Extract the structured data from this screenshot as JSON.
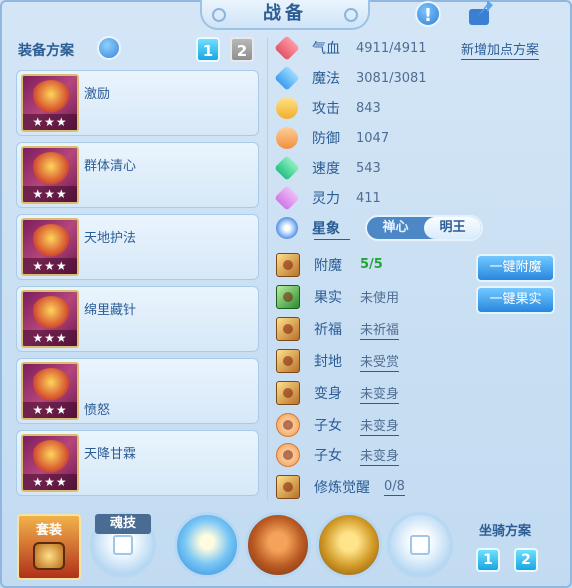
{
  "title": "战备",
  "equip_plan": {
    "label": "装备方案",
    "pages": [
      "1",
      "2"
    ],
    "items": [
      {
        "name": "激励",
        "stars": "★★★"
      },
      {
        "name": "群体清心",
        "stars": "★★★"
      },
      {
        "name": "天地护法",
        "stars": "★★★"
      },
      {
        "name": "绵里藏针",
        "stars": "★★★"
      },
      {
        "name": "愤怒",
        "stars": "★★★"
      },
      {
        "name": "天降甘霖",
        "stars": "★★★"
      }
    ]
  },
  "add_point_plan": "新增加点方案",
  "attributes": [
    {
      "name": "气血",
      "value": "4911/4911",
      "icon": "heart-icon"
    },
    {
      "name": "魔法",
      "value": "3081/3081",
      "icon": "mana-icon"
    },
    {
      "name": "攻击",
      "value": "843",
      "icon": "attack-icon"
    },
    {
      "name": "防御",
      "value": "1047",
      "icon": "defense-icon"
    },
    {
      "name": "速度",
      "value": "543",
      "icon": "speed-icon"
    },
    {
      "name": "灵力",
      "value": "411",
      "icon": "spirit-icon"
    }
  ],
  "star_sign": {
    "label": "星象",
    "options": [
      "禅心",
      "明王"
    ],
    "selected": "明王"
  },
  "specials": [
    {
      "name": "附魔",
      "value": "5/5"
    },
    {
      "name": "果实",
      "value": "未使用"
    },
    {
      "name": "祈福",
      "value": "未祈福"
    },
    {
      "name": "封地",
      "value": "未受赏"
    },
    {
      "name": "变身",
      "value": "未变身"
    },
    {
      "name": "子女",
      "value": "未变身"
    },
    {
      "name": "子女",
      "value": "未变身"
    },
    {
      "name": "修炼觉醒",
      "value": "0/8"
    }
  ],
  "actions": {
    "enchant": "一键附魔",
    "fruit": "一键果实"
  },
  "bottom": {
    "suit": "套装",
    "soul_skill": "魂技",
    "mount_plan": "坐骑方案",
    "mount_pages": [
      "1",
      "2"
    ]
  },
  "colors": {
    "accent": "#2c5d95",
    "button": "#2887df",
    "success": "#23a33a"
  }
}
